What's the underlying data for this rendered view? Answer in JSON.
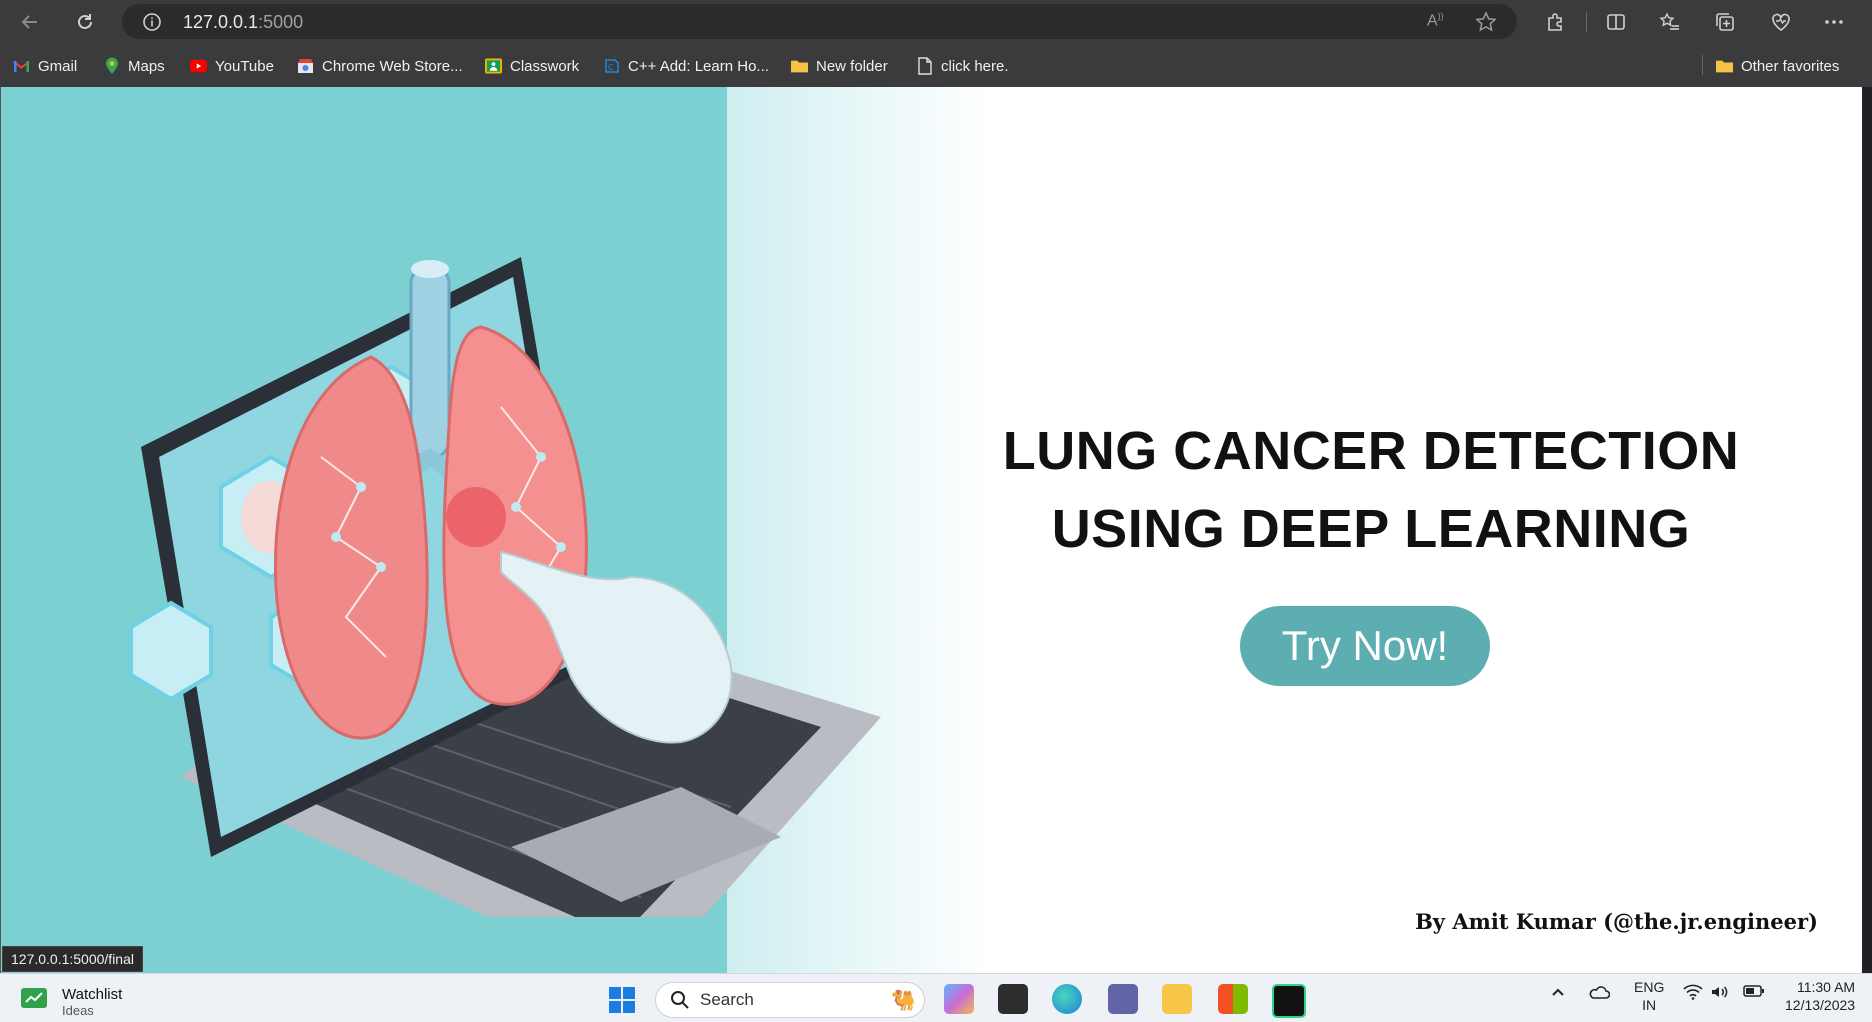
{
  "browser": {
    "url_host": "127.0.0.1",
    "url_port": ":5000",
    "bookmarks": [
      {
        "label": "Gmail",
        "icon": "gmail-icon"
      },
      {
        "label": "Maps",
        "icon": "maps-icon"
      },
      {
        "label": "YouTube",
        "icon": "youtube-icon"
      },
      {
        "label": "Chrome Web Store...",
        "icon": "chrome-web-store-icon"
      },
      {
        "label": "Classwork",
        "icon": "classwork-icon"
      },
      {
        "label": "C++ Add: Learn Ho...",
        "icon": "cpp-icon"
      },
      {
        "label": "New folder",
        "icon": "folder-icon"
      },
      {
        "label": "click here.",
        "icon": "page-icon"
      }
    ],
    "other_favorites": "Other favorites",
    "status_url": "127.0.0.1:5000/final"
  },
  "page": {
    "title_line1": "LUNG CANCER DETECTION",
    "title_line2": "USING DEEP LEARNING",
    "cta_label": "Try Now!",
    "byline": "By Amit Kumar (@the.jr.engineer)"
  },
  "taskbar": {
    "widget_title": "Watchlist",
    "widget_subtitle": "Ideas",
    "search_placeholder": "Search",
    "lang_top": "ENG",
    "lang_bottom": "IN",
    "time": "11:30 AM",
    "date": "12/13/2023"
  },
  "colors": {
    "hero_teal": "#7cd0d2",
    "cta": "#5daeb1"
  }
}
